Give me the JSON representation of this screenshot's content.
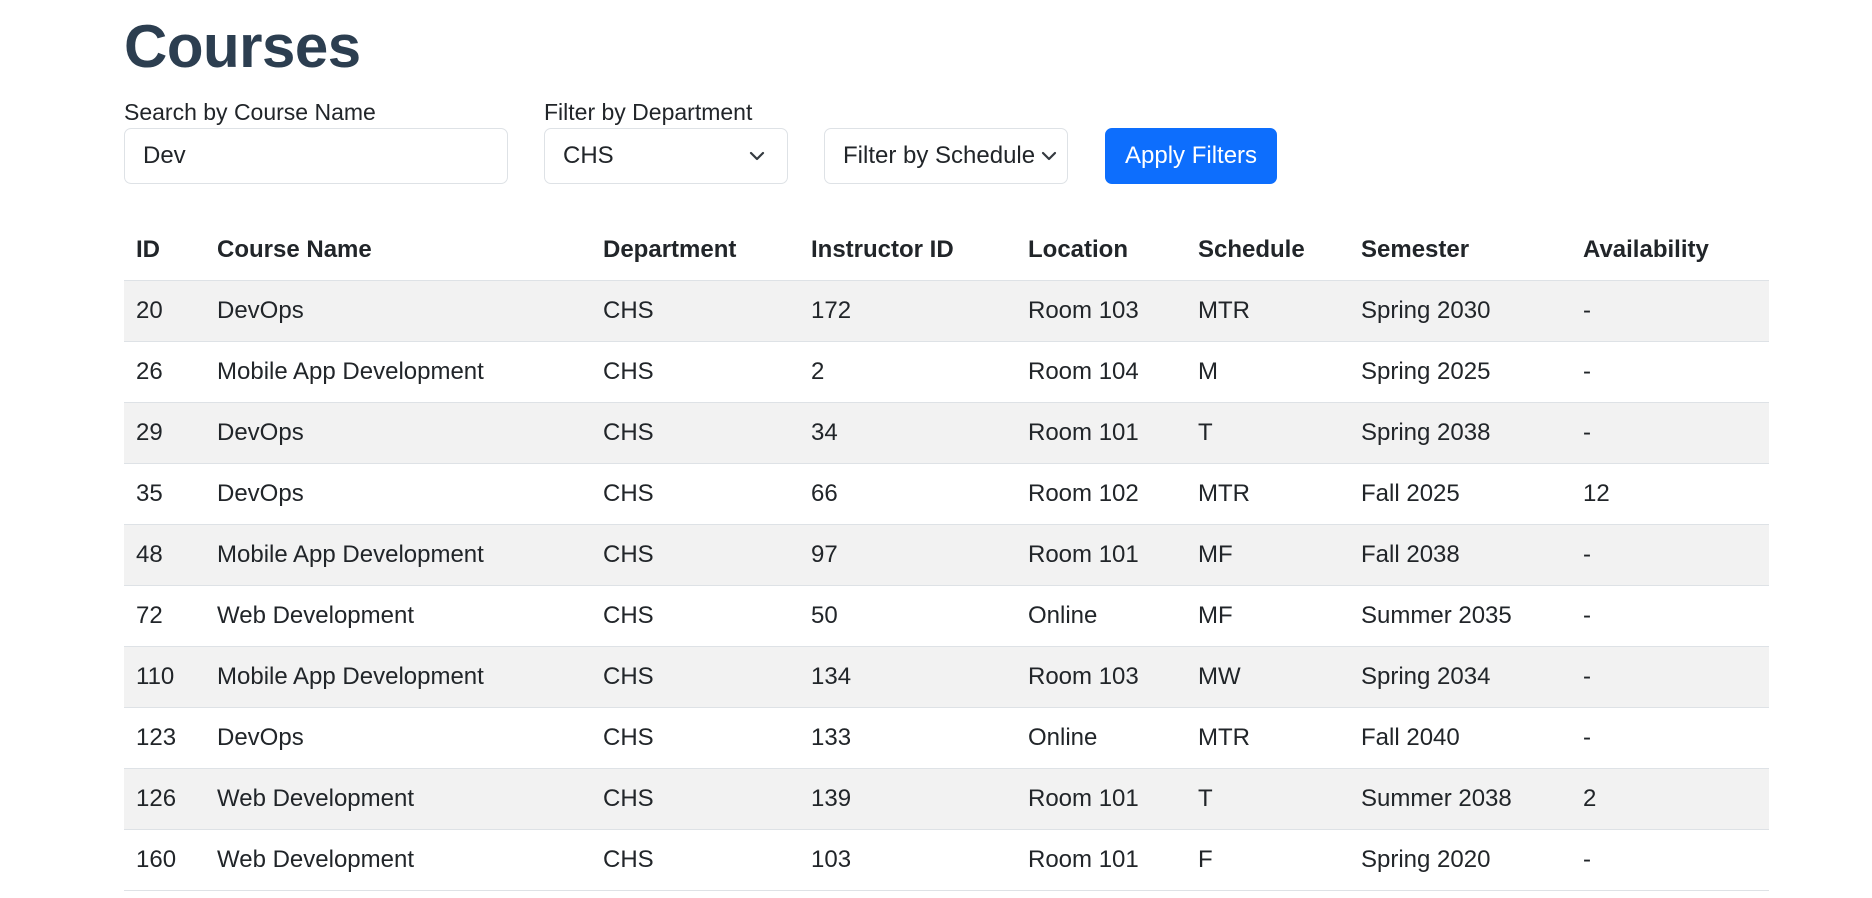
{
  "page": {
    "title": "Courses"
  },
  "filters": {
    "search_label": "Search by Course Name",
    "search_value": "Dev",
    "department_label": "Filter by Department",
    "department_value": "CHS",
    "schedule_value": "Filter by Schedule",
    "apply_label": "Apply Filters"
  },
  "table": {
    "columns": [
      "ID",
      "Course Name",
      "Department",
      "Instructor ID",
      "Location",
      "Schedule",
      "Semester",
      "Availability"
    ],
    "rows": [
      [
        "20",
        "DevOps",
        "CHS",
        "172",
        "Room 103",
        "MTR",
        "Spring 2030",
        "-"
      ],
      [
        "26",
        "Mobile App Development",
        "CHS",
        "2",
        "Room 104",
        "M",
        "Spring 2025",
        "-"
      ],
      [
        "29",
        "DevOps",
        "CHS",
        "34",
        "Room 101",
        "T",
        "Spring 2038",
        "-"
      ],
      [
        "35",
        "DevOps",
        "CHS",
        "66",
        "Room 102",
        "MTR",
        "Fall 2025",
        "12"
      ],
      [
        "48",
        "Mobile App Development",
        "CHS",
        "97",
        "Room 101",
        "MF",
        "Fall 2038",
        "-"
      ],
      [
        "72",
        "Web Development",
        "CHS",
        "50",
        "Online",
        "MF",
        "Summer 2035",
        "-"
      ],
      [
        "110",
        "Mobile App Development",
        "CHS",
        "134",
        "Room 103",
        "MW",
        "Spring 2034",
        "-"
      ],
      [
        "123",
        "DevOps",
        "CHS",
        "133",
        "Online",
        "MTR",
        "Fall 2040",
        "-"
      ],
      [
        "126",
        "Web Development",
        "CHS",
        "139",
        "Room 101",
        "T",
        "Summer 2038",
        "2"
      ],
      [
        "160",
        "Web Development",
        "CHS",
        "103",
        "Room 101",
        "F",
        "Spring 2020",
        "-"
      ]
    ]
  },
  "icons": {
    "department_select": "chevron-down-icon",
    "schedule_select": "chevron-down-icon"
  },
  "colors": {
    "title": "#2c3e50",
    "primary_button": "#0d6efd",
    "stripe": "#f2f2f2"
  }
}
